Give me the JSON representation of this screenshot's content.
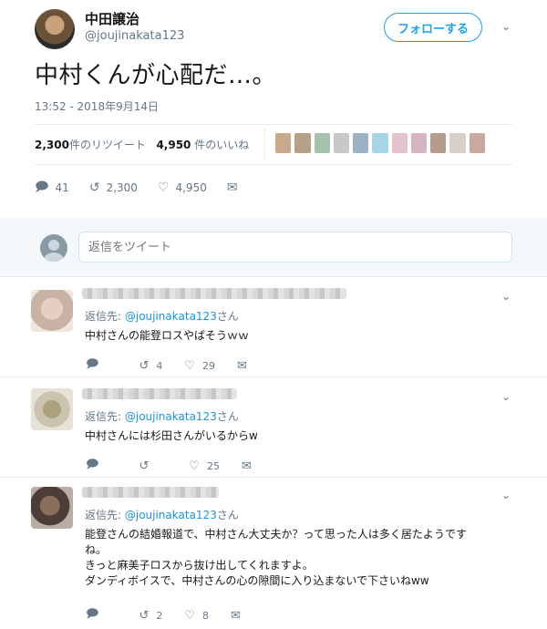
{
  "tweet": {
    "name": "中田譲治",
    "handle": "@joujinakata123",
    "follow_label": "フォローする",
    "text": "中村くんが心配だ…。",
    "timestamp": "13:52 - 2018年9月14日",
    "retweets_count": "2,300",
    "retweets_suffix": "件のリツイート",
    "likes_count": "4,950",
    "likes_suffix": " 件のいいね",
    "actions": {
      "replies": "41",
      "retweets": "2,300",
      "likes": "4,950"
    }
  },
  "reply_box": {
    "placeholder": "返信をツイート"
  },
  "replies": [
    {
      "replying_to_label": "返信先: ",
      "replying_to_handle": "@joujinakata123",
      "replying_to_suffix": "さん",
      "lines": [
        "中村さんの能登ロスやばそうｗｗ"
      ],
      "retweets": "4",
      "likes": "29"
    },
    {
      "replying_to_label": "返信先: ",
      "replying_to_handle": "@joujinakata123",
      "replying_to_suffix": "さん",
      "lines": [
        "中村さんには杉田さんがいるからw"
      ],
      "retweets": "",
      "likes": "25"
    },
    {
      "replying_to_label": "返信先: ",
      "replying_to_handle": "@joujinakata123",
      "replying_to_suffix": "さん",
      "lines": [
        "能登さんの結婚報道で、中村さん大丈夫か？って思った人は多く居たようです",
        "ね。",
        "きっと麻美子ロスから抜け出してくれますよ。",
        "ダンディボイスで、中村さんの心の隙間に入り込まないで下さいねww"
      ],
      "retweets": "2",
      "likes": "8"
    }
  ],
  "icons": {
    "reply": "reply-icon",
    "retweet": "retweet-icon",
    "like": "heart-icon",
    "dm": "envelope-icon",
    "caret": "chevron-down-icon"
  },
  "colors": {
    "accent": "#1da1f2",
    "link": "#1b95e0",
    "muted": "#657786"
  }
}
